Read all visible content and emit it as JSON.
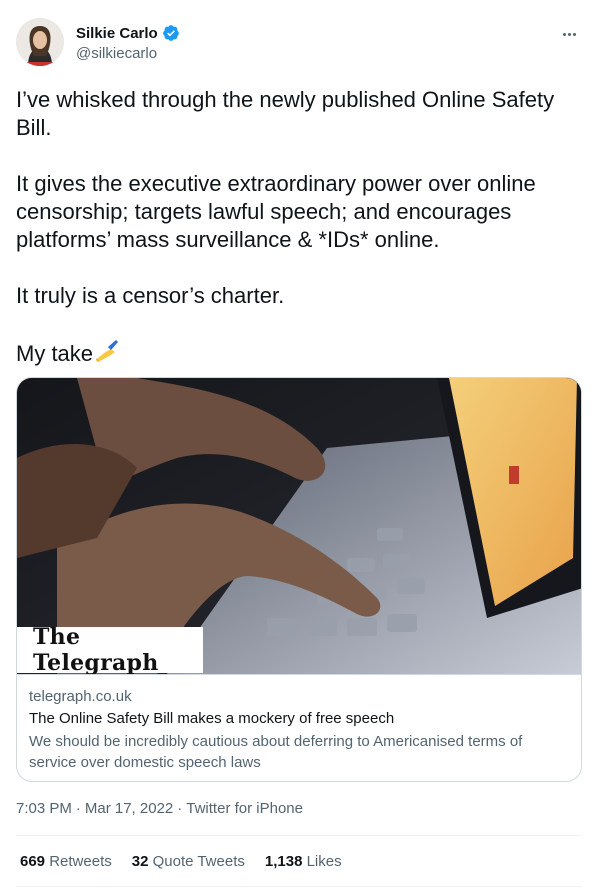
{
  "author": {
    "display_name": "Silkie Carlo",
    "handle": "@silkiecarlo",
    "verified": true
  },
  "icons": {
    "verified": "verified-badge-icon",
    "more": "more-options-icon",
    "emoji": "writing-hand-emoji"
  },
  "tweet": {
    "paragraphs": [
      "I’ve whisked through the newly published Online Safety Bill.",
      "It gives the executive extraordinary power over online censorship; targets lawful speech; and encourages platforms’ mass surveillance & *IDs* online.",
      "It truly is a censor’s charter.",
      "My take"
    ],
    "emoji": "✍️"
  },
  "card": {
    "publisher": "The Telegraph",
    "domain": "telegraph.co.uk",
    "title": "The Online Safety Bill makes a mockery of free speech",
    "description": "We should be incredibly cautious about deferring to Americanised terms of service over domestic speech laws"
  },
  "meta": {
    "time": "7:03 PM",
    "date": "Mar 17, 2022",
    "source": "Twitter for iPhone",
    "separator": "·"
  },
  "stats": {
    "retweets_count": "669",
    "retweets_label": "Retweets",
    "quotes_count": "32",
    "quotes_label": "Quote Tweets",
    "likes_count": "1,138",
    "likes_label": "Likes"
  },
  "colors": {
    "text": "#0f1419",
    "secondary": "#536471",
    "verified": "#1d9bf0",
    "border": "#cfd9de"
  }
}
